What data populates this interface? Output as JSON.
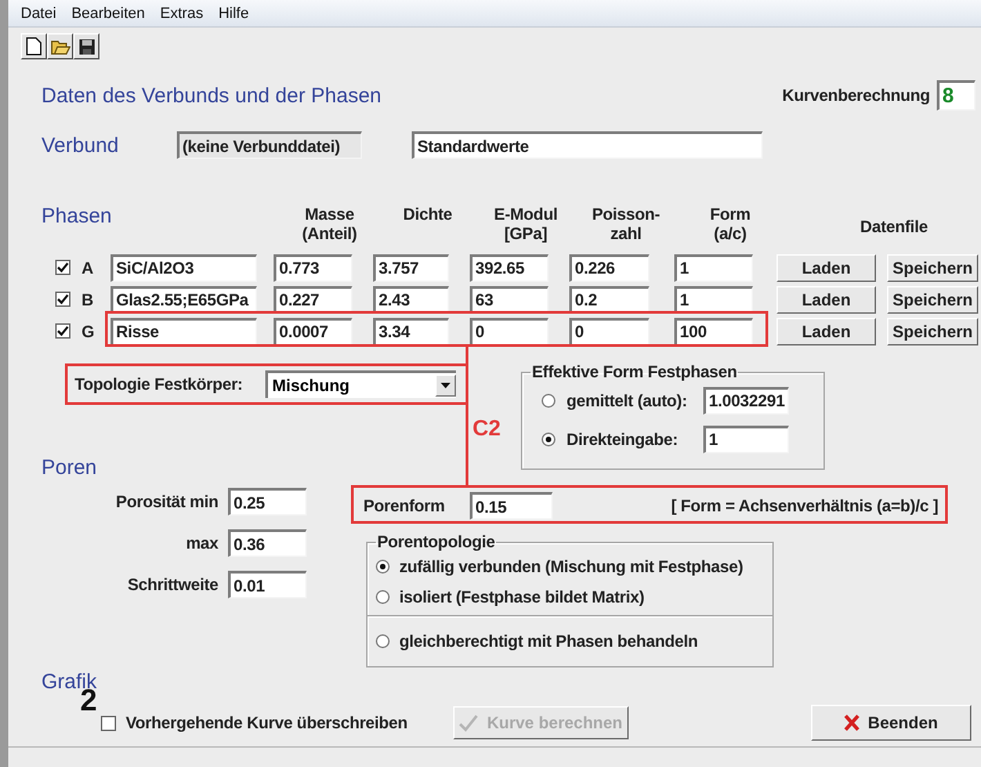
{
  "menu": [
    "Datei",
    "Bearbeiten",
    "Extras",
    "Hilfe"
  ],
  "title": "Daten des Verbunds und der Phasen",
  "curve_calc": {
    "label": "Kurvenberechnung",
    "value": "8"
  },
  "composite": {
    "label": "Verbund",
    "file": "(keine Verbunddatei)",
    "name": "Standardwerte"
  },
  "phases": {
    "heading": "Phasen",
    "columns": [
      [
        "Masse",
        "(Anteil)"
      ],
      [
        "Dichte"
      ],
      [
        "E-Modul",
        "[GPa]"
      ],
      [
        "Poisson-",
        "zahl"
      ],
      [
        "Form",
        "(a/c)"
      ]
    ],
    "datafile_heading": "Datenfile",
    "rows": [
      {
        "checked": true,
        "letter": "A",
        "name": "SiC/Al2O3",
        "values": [
          "0.773",
          "3.757",
          "392.65",
          "0.226",
          "1"
        ],
        "load": "Laden",
        "save": "Speichern"
      },
      {
        "checked": true,
        "letter": "B",
        "name": "Glas2.55;E65GPa",
        "values": [
          "0.227",
          "2.43",
          "63",
          "0.2",
          "1"
        ],
        "load": "Laden",
        "save": "Speichern"
      },
      {
        "checked": true,
        "letter": "G",
        "name": "Risse",
        "values": [
          "0.0007",
          "3.34",
          "0",
          "0",
          "100"
        ],
        "load": "Laden",
        "save": "Speichern"
      }
    ]
  },
  "topology": {
    "label": "Topologie Festkörper:",
    "value": "Mischung"
  },
  "effective_form": {
    "title": "Effektive Form Festphasen",
    "options": [
      {
        "label": "gemittelt (auto):",
        "value": "1.0032291",
        "selected": false
      },
      {
        "label": "Direkteingabe:",
        "value": "1",
        "selected": true
      }
    ]
  },
  "pores": {
    "heading": "Poren",
    "fields": [
      {
        "label": "Porosität min",
        "value": "0.25"
      },
      {
        "label": "max",
        "value": "0.36"
      },
      {
        "label": "Schrittweite",
        "value": "0.01"
      }
    ],
    "shape": {
      "label": "Porenform",
      "value": "0.15",
      "note": "[ Form = Achsenverhältnis (a=b)/c ]"
    },
    "topology": {
      "title": "Porentopologie",
      "groups": [
        [
          {
            "label": "zufällig verbunden (Mischung mit Festphase)",
            "selected": true
          },
          {
            "label": "isoliert (Festphase bildet Matrix)",
            "selected": false
          }
        ],
        [
          {
            "label": "gleichberechtigt mit Phasen behandeln",
            "selected": false
          }
        ]
      ]
    }
  },
  "graphics": {
    "heading": "Grafik",
    "overwrite": {
      "label": "Vorhergehende Kurve überschreiben",
      "checked": false
    }
  },
  "buttons": [
    {
      "kind": "calculate",
      "label": "Kurve berechnen",
      "disabled": true
    },
    {
      "kind": "exit",
      "label": "Beenden",
      "disabled": false
    }
  ],
  "annotation": "C2",
  "figure_number": "2"
}
